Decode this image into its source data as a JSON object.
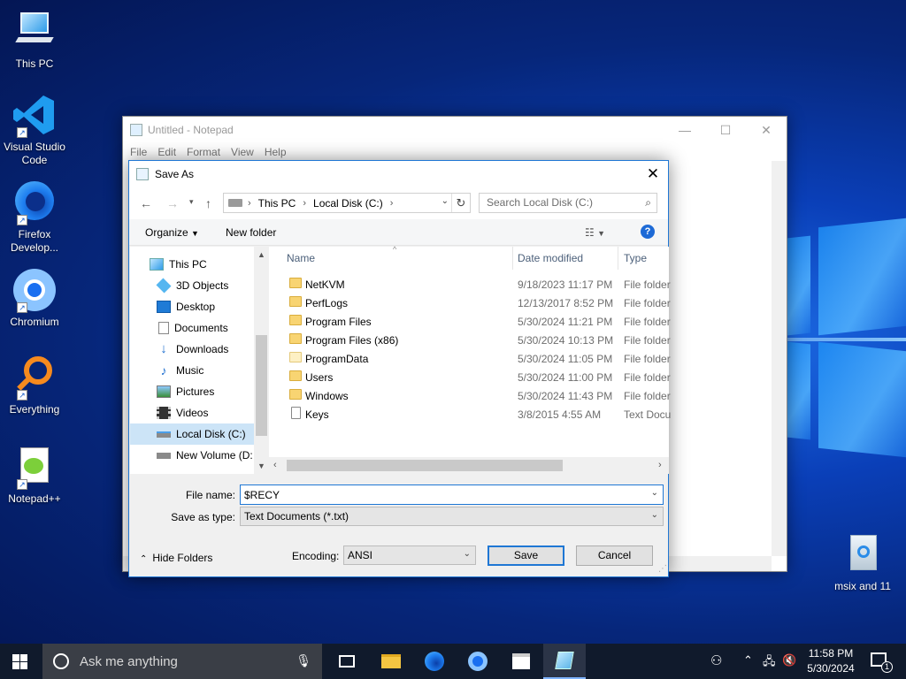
{
  "desktop": {
    "icons": [
      {
        "label": "This PC"
      },
      {
        "label": "Visual Studio Code"
      },
      {
        "label": "Firefox Develop..."
      },
      {
        "label": "Chromium"
      },
      {
        "label": "Everything"
      },
      {
        "label": "Notepad++"
      },
      {
        "label": "msix and 11"
      }
    ]
  },
  "notepad": {
    "title": "Untitled - Notepad",
    "menu": [
      "File",
      "Edit",
      "Format",
      "View",
      "Help"
    ]
  },
  "dialog": {
    "title": "Save As",
    "address": {
      "crumbs": [
        "This PC",
        "Local Disk (C:)"
      ]
    },
    "search_placeholder": "Search Local Disk (C:)",
    "organize_label": "Organize",
    "new_folder_label": "New folder",
    "nav_items": [
      {
        "label": "This PC",
        "icon": "computer-icon"
      },
      {
        "label": "3D Objects",
        "icon": "cube-icon"
      },
      {
        "label": "Desktop",
        "icon": "desktop-icon"
      },
      {
        "label": "Documents",
        "icon": "document-icon"
      },
      {
        "label": "Downloads",
        "icon": "download-icon"
      },
      {
        "label": "Music",
        "icon": "music-icon"
      },
      {
        "label": "Pictures",
        "icon": "picture-icon"
      },
      {
        "label": "Videos",
        "icon": "video-icon"
      },
      {
        "label": "Local Disk (C:)",
        "icon": "drive-icon",
        "selected": true
      },
      {
        "label": "New Volume (D:",
        "icon": "drive-icon"
      }
    ],
    "columns": {
      "name": "Name",
      "date": "Date modified",
      "type": "Type"
    },
    "files": [
      {
        "name": "NetKVM",
        "date": "9/18/2023 11:17 PM",
        "type": "File folder",
        "kind": "folder"
      },
      {
        "name": "PerfLogs",
        "date": "12/13/2017 8:52 PM",
        "type": "File folder",
        "kind": "folder"
      },
      {
        "name": "Program Files",
        "date": "5/30/2024 11:21 PM",
        "type": "File folder",
        "kind": "folder"
      },
      {
        "name": "Program Files (x86)",
        "date": "5/30/2024 10:13 PM",
        "type": "File folder",
        "kind": "folder"
      },
      {
        "name": "ProgramData",
        "date": "5/30/2024 11:05 PM",
        "type": "File folder",
        "kind": "folder"
      },
      {
        "name": "Users",
        "date": "5/30/2024 11:00 PM",
        "type": "File folder",
        "kind": "folder"
      },
      {
        "name": "Windows",
        "date": "5/30/2024 11:43 PM",
        "type": "File folder",
        "kind": "folder"
      },
      {
        "name": "Keys",
        "date": "3/8/2015 4:55 AM",
        "type": "Text Docu",
        "kind": "document"
      }
    ],
    "file_name_label": "File name:",
    "file_name_value": "$RECY",
    "save_type_label": "Save as type:",
    "save_type_value": "Text Documents (*.txt)",
    "hide_folders_label": "Hide Folders",
    "encoding_label": "Encoding:",
    "encoding_value": "ANSI",
    "save_label": "Save",
    "cancel_label": "Cancel"
  },
  "taskbar": {
    "search_placeholder": "Ask me anything",
    "time": "11:58 PM",
    "date": "5/30/2024",
    "notification_count": "1"
  },
  "colors": {
    "accent": "#1f77d4",
    "selection": "#cce4f7",
    "taskbar": "#101a2c"
  }
}
